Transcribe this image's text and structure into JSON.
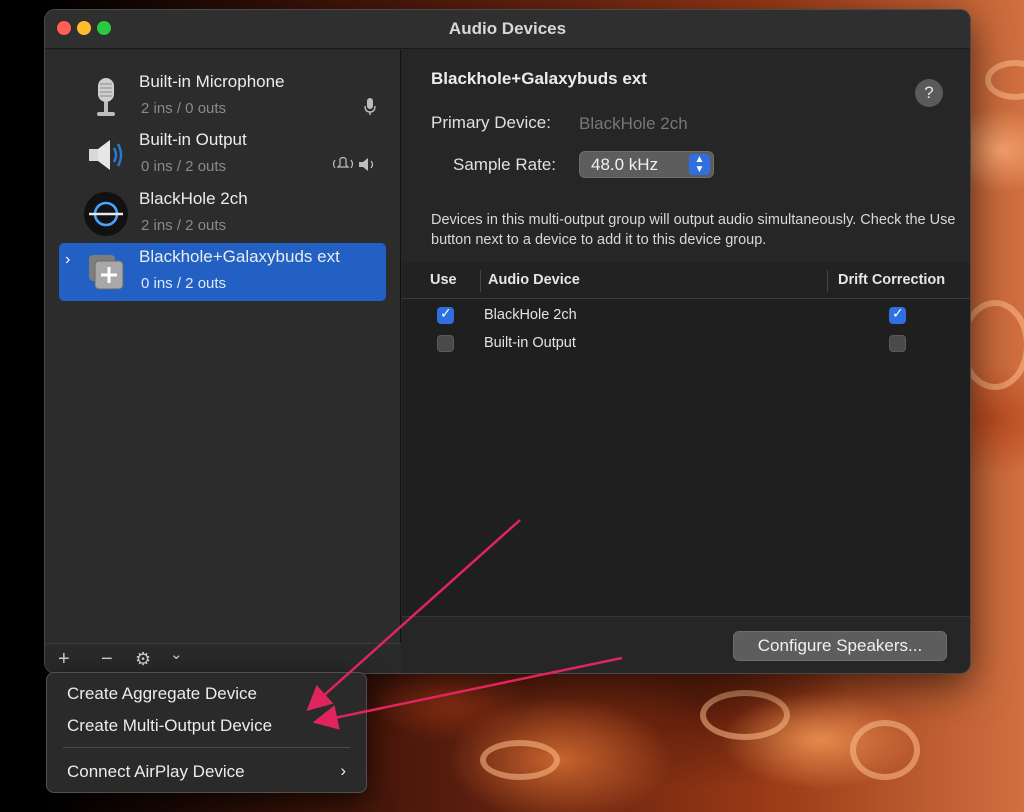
{
  "window": {
    "title": "Audio Devices"
  },
  "sidebar": {
    "items": [
      {
        "name": "Built-in Microphone",
        "io": "2 ins / 0 outs",
        "icon": "microphone-icon"
      },
      {
        "name": "Built-in Output",
        "io": "0 ins / 2 outs",
        "icon": "speaker-icon"
      },
      {
        "name": "BlackHole 2ch",
        "io": "2 ins / 2 outs",
        "icon": "blackhole-icon"
      },
      {
        "name": "Blackhole+Galaxybuds ext",
        "io": "0 ins / 2 outs",
        "icon": "multi-output-icon",
        "selected": true
      }
    ],
    "toolbar": {
      "add": "+",
      "remove": "−",
      "gear": "⚙",
      "chevron": "⌄"
    }
  },
  "detail": {
    "title": "Blackhole+Galaxybuds ext",
    "help": "?",
    "primary_label": "Primary Device:",
    "primary_value": "BlackHole 2ch",
    "sample_rate_label": "Sample Rate:",
    "sample_rate_value": "48.0 kHz",
    "description": "Devices in this multi-output group will output audio simultaneously. Check the Use button next to a device to add it to this device group.",
    "table": {
      "headers": {
        "use": "Use",
        "device": "Audio Device",
        "drift": "Drift Correction"
      },
      "rows": [
        {
          "use": true,
          "device": "BlackHole 2ch",
          "drift": true
        },
        {
          "use": false,
          "device": "Built-in Output",
          "drift": false
        }
      ]
    },
    "configure_button": "Configure Speakers..."
  },
  "menu": {
    "items": [
      {
        "label": "Create Aggregate Device"
      },
      {
        "label": "Create Multi-Output Device"
      },
      {
        "label": "Connect AirPlay Device",
        "submenu": true
      }
    ],
    "submenu_arrow": "›"
  },
  "colors": {
    "selection": "#2260c4",
    "accent": "#2f6fe0",
    "annotation_arrow": "#e0245e"
  }
}
